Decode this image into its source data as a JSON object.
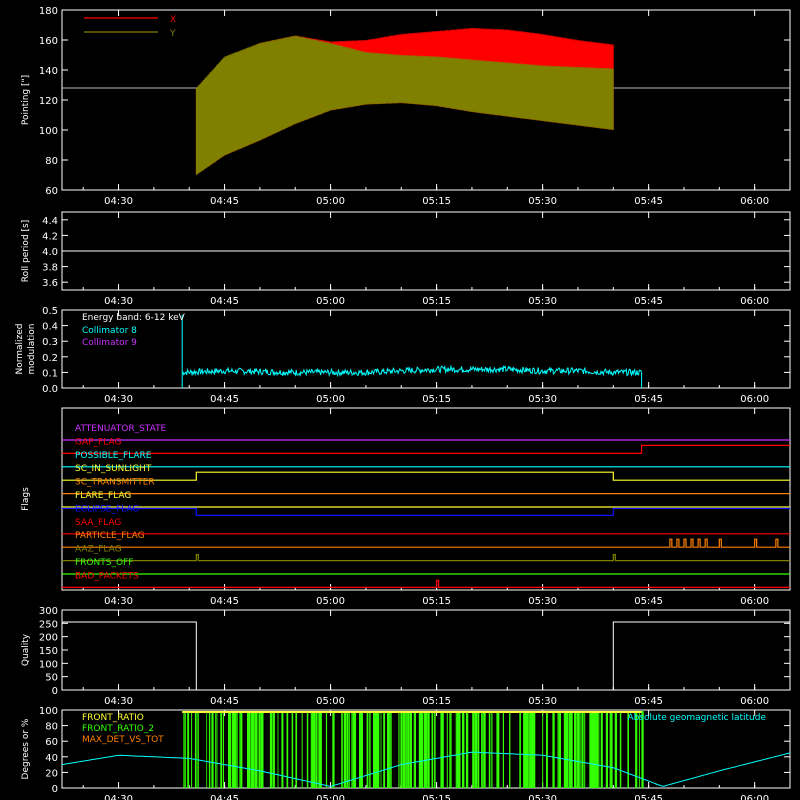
{
  "time_ticks": [
    "04:30",
    "04:45",
    "05:00",
    "05:15",
    "05:30",
    "05:45",
    "06:00"
  ],
  "colors": {
    "x": "#ff0000",
    "y": "#808000",
    "cyan": "#00ffff",
    "magenta": "#cc33ff",
    "white": "#ffffff",
    "green": "#33ff00",
    "yellow": "#ffff33",
    "orange": "#ff8000",
    "red": "#ff0000",
    "blue": "#1111ff"
  },
  "chart_data": [
    {
      "type": "area",
      "ylabel": "Pointing [\"]",
      "ylim": [
        60,
        180
      ],
      "yticks": [
        "60",
        "80",
        "100",
        "120",
        "140",
        "160",
        "180"
      ],
      "xlim": [
        "04:22",
        "06:05"
      ],
      "legend": [
        {
          "name": "X",
          "color": "#ff0000"
        },
        {
          "name": "Y",
          "color": "#808000"
        }
      ],
      "reference_line": 128,
      "series": [
        {
          "name": "X",
          "x": [
            "04:41",
            "04:45",
            "04:50",
            "04:55",
            "05:00",
            "05:05",
            "05:10",
            "05:15",
            "05:20",
            "05:25",
            "05:30",
            "05:35",
            "05:40"
          ],
          "upper": [
            128,
            148,
            158,
            163,
            159,
            160,
            164,
            166,
            168,
            167,
            164,
            160,
            157
          ],
          "lower": [
            70,
            83,
            93,
            104,
            113,
            117,
            118,
            116,
            112,
            109,
            106,
            103,
            100
          ]
        },
        {
          "name": "Y",
          "x": [
            "04:41",
            "04:45",
            "04:50",
            "04:55",
            "05:00",
            "05:05",
            "05:10",
            "05:15",
            "05:20",
            "05:25",
            "05:30",
            "05:35",
            "05:40"
          ],
          "upper": [
            128,
            149,
            158,
            163,
            158,
            152,
            150,
            149,
            147,
            145,
            143,
            142,
            141
          ],
          "lower": [
            70,
            83,
            93,
            104,
            113,
            117,
            118,
            116,
            112,
            109,
            106,
            103,
            100
          ]
        }
      ]
    },
    {
      "type": "line",
      "ylabel": "Roll period [s]",
      "ylim": [
        3.5,
        4.5
      ],
      "yticks": [
        "3.6",
        "3.8",
        "4.0",
        "4.2",
        "4.4"
      ],
      "series": [
        {
          "name": "",
          "x": [
            "04:22",
            "06:05"
          ],
          "values": [
            4.0,
            4.0
          ]
        }
      ]
    },
    {
      "type": "line",
      "ylabel": "Normalized modulation",
      "ylim": [
        0,
        0.5
      ],
      "yticks": [
        "0.0",
        "0.1",
        "0.2",
        "0.3",
        "0.4",
        "0.5"
      ],
      "annotation": "Energy band: 6-12 keV",
      "legend": [
        {
          "name": "Collimator 8",
          "color": "#00ffff"
        },
        {
          "name": "Collimator 9",
          "color": "#cc33ff"
        }
      ],
      "series": [
        {
          "name": "Collimator 8",
          "x": [
            "04:39",
            "04:45",
            "04:55",
            "05:05",
            "05:15",
            "05:20",
            "05:25",
            "05:30",
            "05:35",
            "05:40",
            "05:44"
          ],
          "values": [
            0.1,
            0.11,
            0.1,
            0.1,
            0.12,
            0.12,
            0.12,
            0.11,
            0.11,
            0.1,
            0.1
          ]
        }
      ]
    },
    {
      "type": "line",
      "ylabel": "Flags",
      "flags": [
        {
          "name": "ATTENUATOR_STATE",
          "color": "#cc33ff"
        },
        {
          "name": "GAP_FLAG",
          "color": "#ff0000"
        },
        {
          "name": "POSSIBLE_FLARE",
          "color": "#00ffff"
        },
        {
          "name": "SC_IN_SUNLIGHT",
          "color": "#ffff33"
        },
        {
          "name": "SC_TRANSMITTER",
          "color": "#ff8000"
        },
        {
          "name": "FLARE_FLAG",
          "color": "#ffff33"
        },
        {
          "name": "ECLIPSE_FLAG",
          "color": "#1111ff"
        },
        {
          "name": "SAA_FLAG",
          "color": "#ff0000"
        },
        {
          "name": "PARTICLE_FLAG",
          "color": "#ff8000"
        },
        {
          "name": "AAZ_FLAG",
          "color": "#808000"
        },
        {
          "name": "FRONTS_OFF",
          "color": "#33ff00"
        },
        {
          "name": "BAD_PACKETS",
          "color": "#ff0000"
        }
      ]
    },
    {
      "type": "line",
      "ylabel": "Quality",
      "ylim": [
        0,
        300
      ],
      "yticks": [
        "0",
        "50",
        "100",
        "150",
        "200",
        "250",
        "300"
      ],
      "series": [
        {
          "name": "",
          "x": [
            "04:22",
            "04:41",
            "04:41",
            "05:40",
            "05:40",
            "06:05"
          ],
          "values": [
            255,
            255,
            0,
            0,
            255,
            255
          ]
        }
      ]
    },
    {
      "type": "line",
      "ylabel": "Degrees or %",
      "ylim": [
        0,
        100
      ],
      "yticks": [
        "0",
        "20",
        "40",
        "60",
        "80",
        "100"
      ],
      "legend": [
        {
          "name": "FRONT_RATIO",
          "color": "#ffff33"
        },
        {
          "name": "FRONT_RATIO_2",
          "color": "#33ff00"
        },
        {
          "name": "MAX_DET_VS_TOT",
          "color": "#ff8000"
        }
      ],
      "annotation": "Absolute geomagnetic latitude",
      "series": [
        {
          "name": "Absolute geomagnetic latitude",
          "x": [
            "04:22",
            "04:30",
            "04:40",
            "04:50",
            "05:00",
            "05:10",
            "05:20",
            "05:30",
            "05:40",
            "05:47",
            "05:55",
            "06:05"
          ],
          "values": [
            30,
            42,
            38,
            22,
            2,
            30,
            46,
            42,
            26,
            2,
            22,
            45
          ]
        }
      ]
    }
  ]
}
